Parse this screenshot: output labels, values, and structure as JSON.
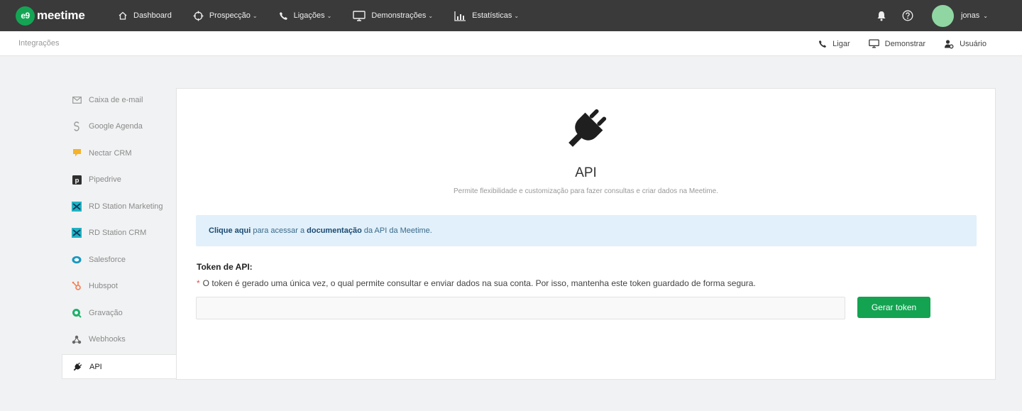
{
  "app": {
    "logo_badge": "e9",
    "logo_text": "meetime"
  },
  "nav": {
    "items": [
      {
        "label": "Dashboard",
        "icon": "home-icon",
        "dropdown": false
      },
      {
        "label": "Prospecção",
        "icon": "crosshair-icon",
        "dropdown": true
      },
      {
        "label": "Ligações",
        "icon": "phone-icon",
        "dropdown": true
      },
      {
        "label": "Demonstrações",
        "icon": "monitor-icon",
        "dropdown": true
      },
      {
        "label": "Estatísticas",
        "icon": "chart-icon",
        "dropdown": true
      }
    ],
    "chevron": "⌄"
  },
  "user": {
    "name": "jonas",
    "avatar_color": "#8fd6a3"
  },
  "subheader": {
    "breadcrumb": "Integrações",
    "actions": [
      {
        "label": "Ligar",
        "icon": "phone-icon"
      },
      {
        "label": "Demonstrar",
        "icon": "monitor-icon"
      },
      {
        "label": "Usuário",
        "icon": "user-gear-icon"
      }
    ]
  },
  "sidebar": {
    "items": [
      {
        "label": "Caixa de e-mail",
        "icon": "envelope-icon"
      },
      {
        "label": "Google Agenda",
        "icon": "google-icon"
      },
      {
        "label": "Nectar CRM",
        "icon": "nectar-icon"
      },
      {
        "label": "Pipedrive",
        "icon": "pipedrive-icon"
      },
      {
        "label": "RD Station Marketing",
        "icon": "rdstation-icon"
      },
      {
        "label": "RD Station CRM",
        "icon": "rdstation-icon"
      },
      {
        "label": "Salesforce",
        "icon": "salesforce-icon"
      },
      {
        "label": "Hubspot",
        "icon": "hubspot-icon"
      },
      {
        "label": "Gravação",
        "icon": "recording-icon"
      },
      {
        "label": "Webhooks",
        "icon": "webhooks-icon"
      },
      {
        "label": "API",
        "icon": "plug-icon",
        "active": true
      }
    ]
  },
  "main": {
    "title": "API",
    "subtitle": "Permite flexibilidade e customização para fazer consultas e criar dados na Meetime.",
    "info": {
      "link1": "Clique aqui",
      "text1": " para acessar a ",
      "link2": "documentação",
      "text2": " da API da Meetime."
    },
    "token_label": "Token de API:",
    "token_required_mark": "*",
    "token_note": "O token é gerado uma única vez, o qual permite consultar e enviar dados na sua conta. Por isso, mantenha este token guardado de forma segura.",
    "token_value": "",
    "token_button": "Gerar token"
  },
  "colors": {
    "topbar": "#3a3a3a",
    "brand_green": "#14a554",
    "button_green": "#13a351",
    "info_bg": "#e1f0fa"
  }
}
